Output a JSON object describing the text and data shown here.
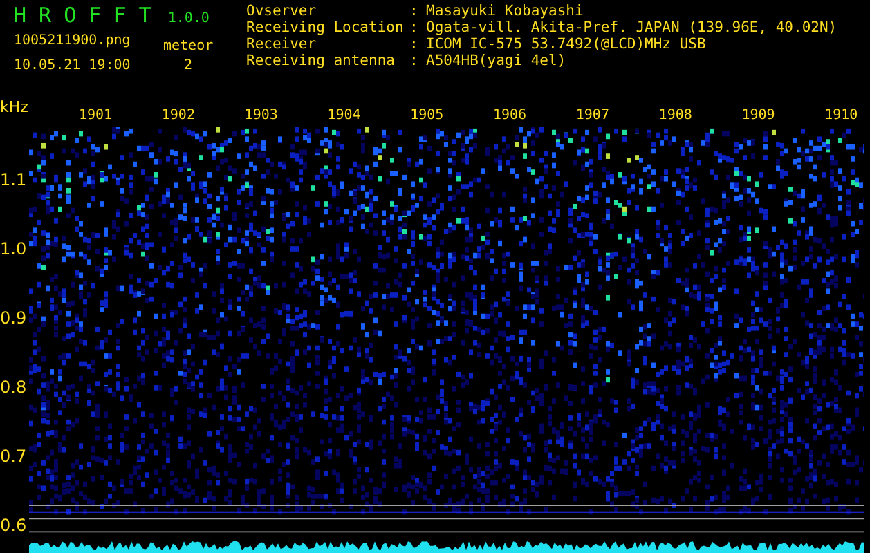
{
  "app": {
    "name": "H R O F F T",
    "version": "1.0.0"
  },
  "file": {
    "filename": "1005211900.png",
    "datetime": "10.05.21 19:00"
  },
  "meteor": {
    "label": "meteor",
    "count": "2"
  },
  "station_info": [
    {
      "label": "Ovserver",
      "separator": ":",
      "value": "Masayuki Kobayashi"
    },
    {
      "label": "Receiving Location",
      "separator": ":",
      "value": "Ogata-vill. Akita-Pref. JAPAN (139.96E, 40.02N)"
    },
    {
      "label": "Receiver",
      "separator": ":",
      "value": "ICOM IC-575 53.7492(@LCD)MHz USB"
    },
    {
      "label": "Receiving antenna",
      "separator": ":",
      "value": "A504HB(yagi 4el)"
    }
  ],
  "spectrogram": {
    "y_unit": "kHz",
    "y_labels": [
      "1.1",
      "1.0",
      "0.9",
      "0.8",
      "0.7",
      "0.6"
    ],
    "time_labels": [
      "1901",
      "1902",
      "1903",
      "1904",
      "1905",
      "1906",
      "1907",
      "1908",
      "1909",
      "1910"
    ]
  }
}
